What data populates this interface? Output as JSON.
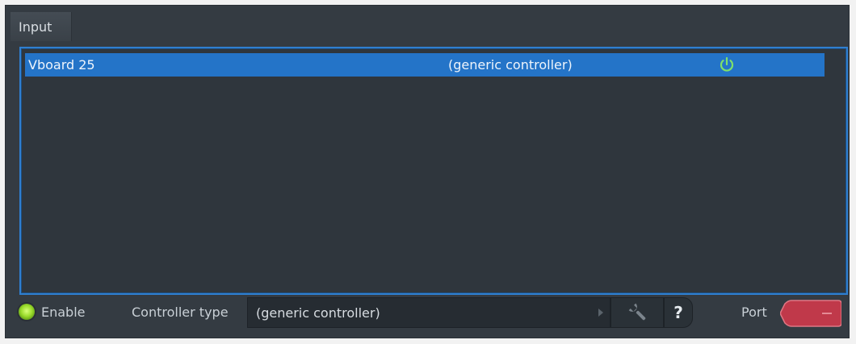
{
  "panel": {
    "title": "Input"
  },
  "devices": [
    {
      "name": "Vboard 25",
      "controller": "(generic controller)",
      "power_icon": "power-icon"
    }
  ],
  "footer": {
    "enable_label": "Enable",
    "controller_type_label": "Controller type",
    "controller_type_value": "(generic controller)",
    "help_label": "?",
    "port_label": "Port",
    "port_value": ""
  },
  "colors": {
    "selection": "#2474c8",
    "power_icon": "#7fe06a",
    "enable_led": "#9bdc2c",
    "port_badge": "#c0394a",
    "panel_bg": "#343b42"
  }
}
